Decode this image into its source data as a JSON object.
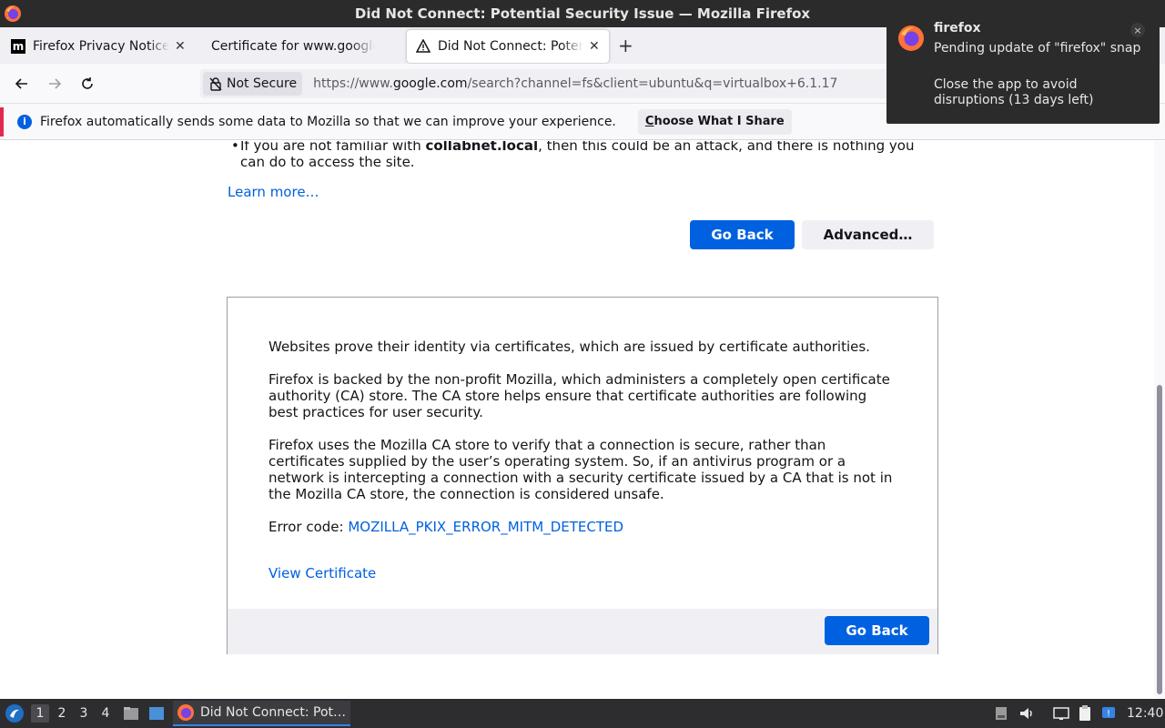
{
  "window": {
    "title": "Did Not Connect: Potential Security Issue — Mozilla Firefox"
  },
  "tabs": [
    {
      "label": "Firefox Privacy Notice — M",
      "favicon": "m"
    },
    {
      "label": "Certificate for www.google.c"
    },
    {
      "label": "Did Not Connect: Potential"
    }
  ],
  "toolbar": {
    "security_label": "Not Secure",
    "url_prefix": "https://www.",
    "url_host": "google.com",
    "url_path": "/search?channel=fs&client=ubuntu&q=virtualbox+6.1.17"
  },
  "infobar": {
    "message": "Firefox automatically sends some data to Mozilla so that we can improve your experience.",
    "button_prefix": "C",
    "button_rest": "hoose What I Share"
  },
  "page": {
    "bullet_pre": "If you are not familiar with ",
    "bullet_bold": "collabnet.local",
    "bullet_post": ", then this could be an attack, and there is nothing you can do to access the site.",
    "learn_more": "Learn more…",
    "go_back": "Go Back",
    "advanced": "Advanced…",
    "adv_p1": "Websites prove their identity via certificates, which are issued by certificate authorities.",
    "adv_p2": "Firefox is backed by the non-profit Mozilla, which administers a completely open certificate authority (CA) store. The CA store helps ensure that certificate authorities are following best practices for user security.",
    "adv_p3": "Firefox uses the Mozilla CA store to verify that a connection is secure, rather than certificates supplied by the user’s operating system. So, if an antivirus program or a network is intercepting a connection with a security certificate issued by a CA that is not in the Mozilla CA store, the connection is considered unsafe.",
    "error_label": "Error code: ",
    "error_code": "MOZILLA_PKIX_ERROR_MITM_DETECTED",
    "view_certificate": "View Certificate",
    "go_back_2": "Go Back"
  },
  "notification": {
    "app": "firefox",
    "line1": "Pending update of \"firefox\" snap",
    "line2": "Close the app to avoid disruptions (13 days left)",
    "close": "×"
  },
  "taskbar": {
    "workspaces": [
      "1",
      "2",
      "3",
      "4"
    ],
    "task_label": "Did Not Connect: Pot…",
    "clock": "12:40"
  },
  "colors": {
    "accent_blue": "#0061e0",
    "link": "#0060df",
    "infobar_accent": "#e22850"
  }
}
